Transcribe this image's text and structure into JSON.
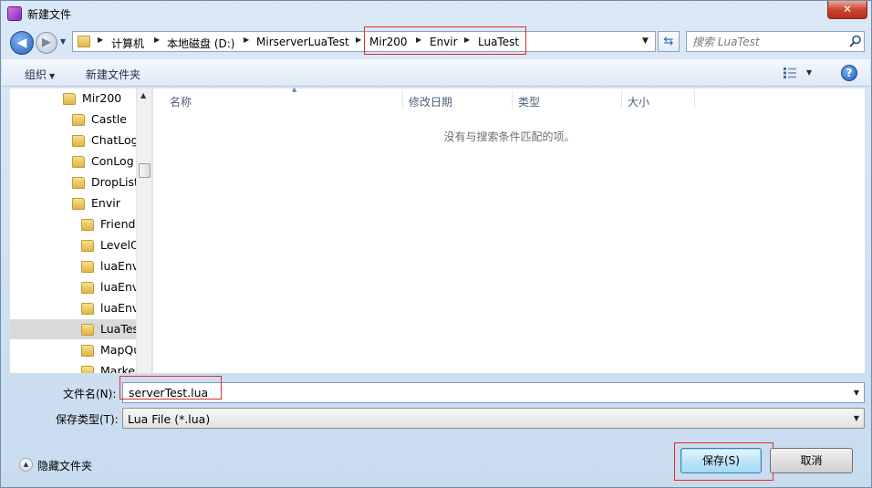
{
  "window": {
    "title": "新建文件",
    "close_glyph": "✕"
  },
  "address": {
    "segments": [
      "计算机",
      "本地磁盘 (D:)",
      "MirserverLuaTest",
      "Mir200",
      "Envir",
      "LuaTest"
    ]
  },
  "search": {
    "placeholder": "搜索 LuaTest"
  },
  "toolbar": {
    "organize_label": "组织",
    "new_folder_label": "新建文件夹"
  },
  "tree": {
    "items": [
      {
        "label": "Mir200"
      },
      {
        "label": "Castle"
      },
      {
        "label": "ChatLog"
      },
      {
        "label": "ConLog"
      },
      {
        "label": "DropList"
      },
      {
        "label": "Envir"
      },
      {
        "label": "Friends"
      },
      {
        "label": "LevelO"
      },
      {
        "label": "luaEnvi"
      },
      {
        "label": "luaEnvi"
      },
      {
        "label": "luaEnvi"
      },
      {
        "label": "LuaTes"
      },
      {
        "label": "MapQu"
      },
      {
        "label": "Marke"
      }
    ],
    "selected": "LuaTes"
  },
  "columns": {
    "name": "名称",
    "modified": "修改日期",
    "type": "类型",
    "size": "大小"
  },
  "empty_message": "没有与搜索条件匹配的项。",
  "form": {
    "filename_label": "文件名(N):",
    "filename_value": "serverTest.lua",
    "filetype_label": "保存类型(T):",
    "filetype_value": "Lua File (*.lua)"
  },
  "footer": {
    "hide_folders_label": "隐藏文件夹",
    "save_label": "保存(S)",
    "cancel_label": "取消"
  },
  "colors": {
    "highlight_box": "#e52b2b",
    "accent": "#2a62b8"
  }
}
